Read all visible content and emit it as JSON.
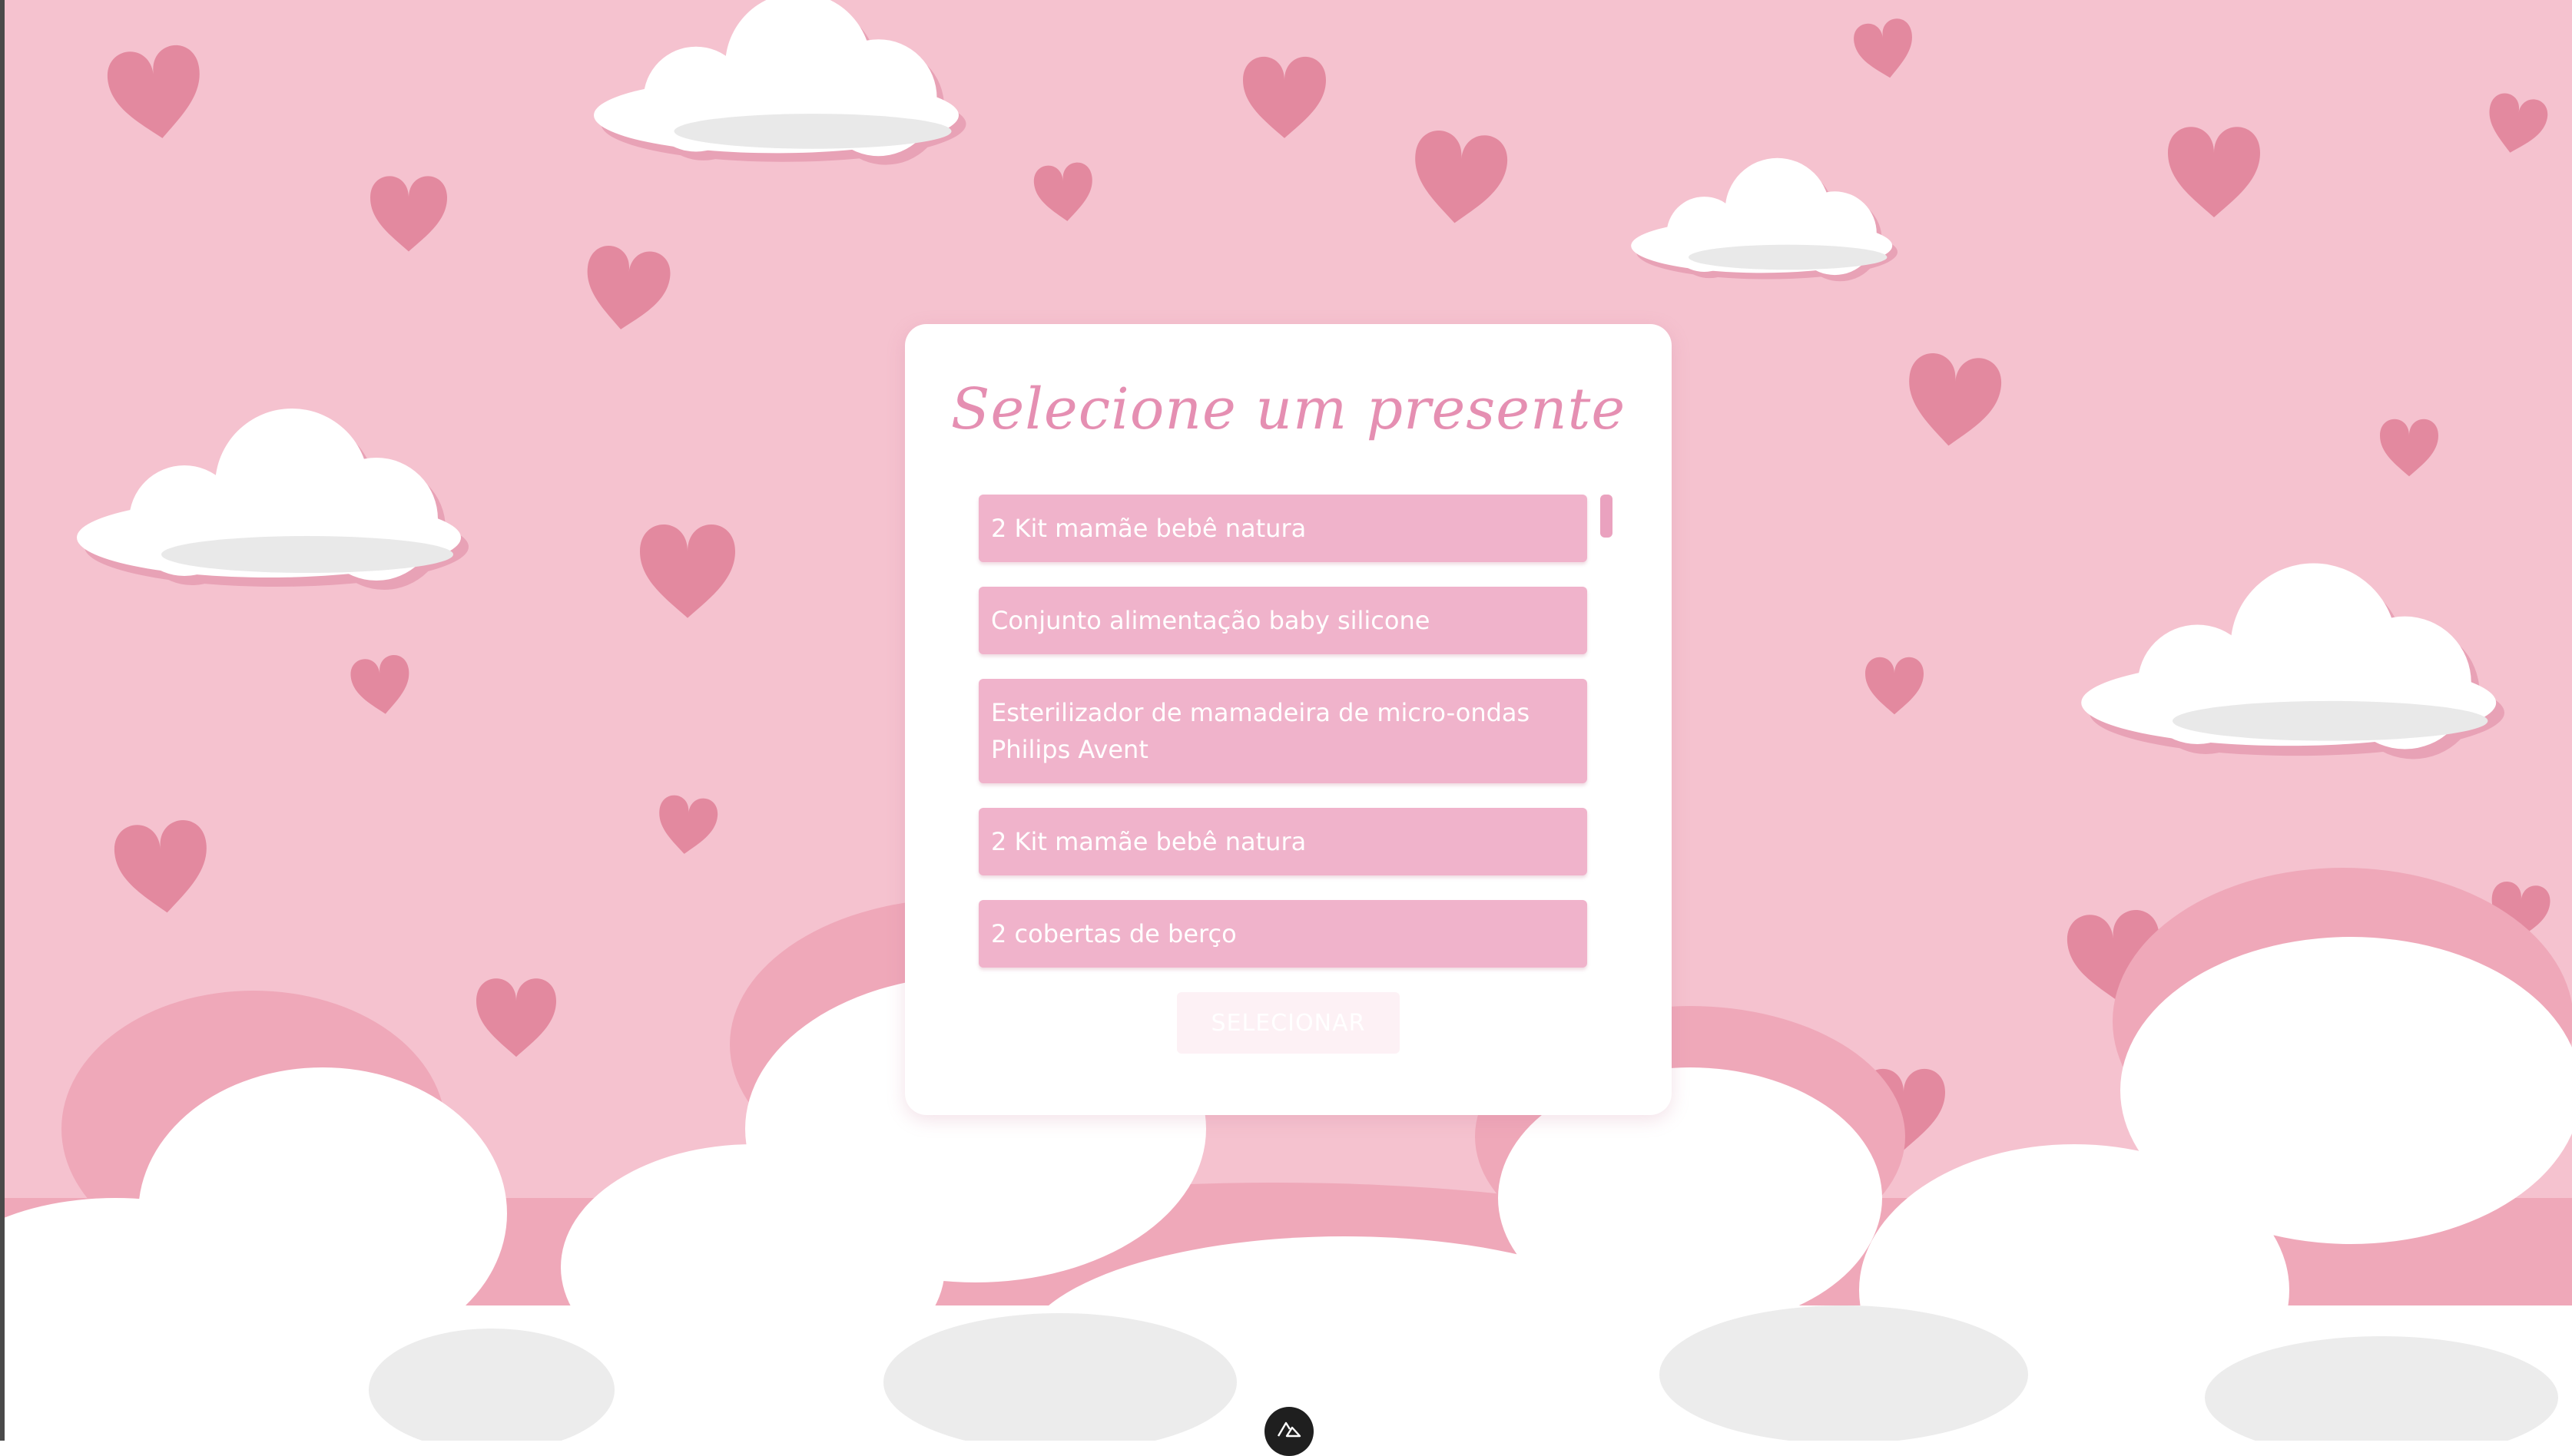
{
  "modal": {
    "title": "Selecione um presente",
    "items": [
      {
        "label": "2 Kit mamãe bebê natura"
      },
      {
        "label": "Conjunto alimentação baby silicone"
      },
      {
        "label": "Esterilizador de mamadeira de micro-ondas Philips Avent"
      },
      {
        "label": "2 Kit mamãe bebê natura"
      },
      {
        "label": "2 cobertas de berço"
      }
    ],
    "select_label": "SELECIONAR"
  },
  "icons": {
    "heart": "heart-icon",
    "cloud": "cloud-icon",
    "framework_badge": "nuxt-icon"
  },
  "colors": {
    "background": "#f5c2cf",
    "heart": "#e3899f",
    "item": "#f0b3cb",
    "title": "#e58fb2",
    "button_disabled": "#fdf1f5"
  }
}
